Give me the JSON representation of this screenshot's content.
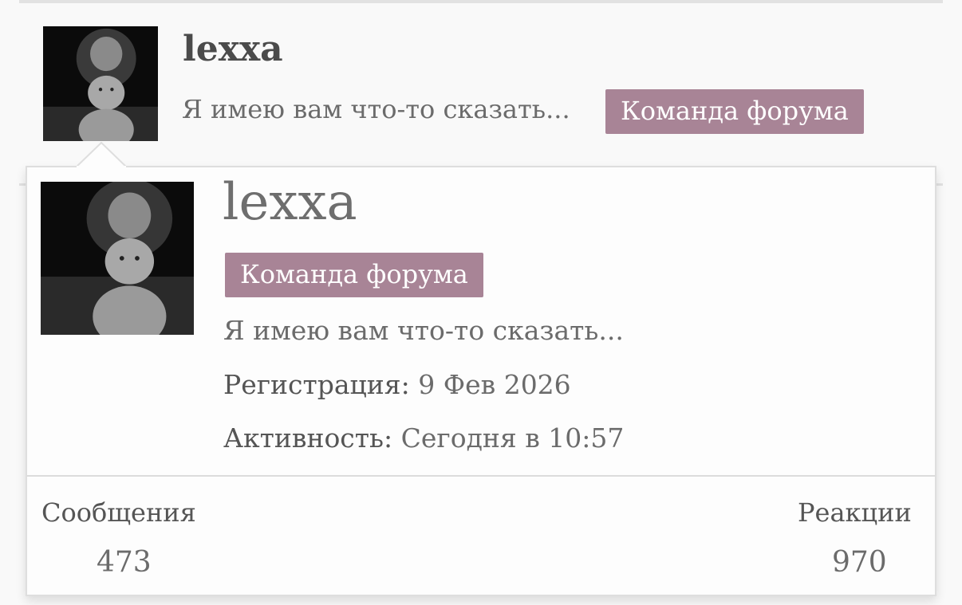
{
  "post": {
    "username": "lexxa",
    "status_text": "Я имею вам что-то сказать...",
    "badge": "Команда форума",
    "avatar_icon": "lion-lioness-avatar"
  },
  "profile_card": {
    "username": "lexxa",
    "badge": "Команда форума",
    "status_text": "Я имею вам что-то сказать...",
    "registration": {
      "label": "Регистрация:",
      "value": "9 Фев 2026"
    },
    "activity": {
      "label": "Активность:",
      "value": "Сегодня в 10:57"
    },
    "stats": [
      {
        "label": "Сообщения",
        "value": "473"
      },
      {
        "label": "Реакции",
        "value": "970"
      }
    ],
    "avatar_icon": "lion-lioness-avatar"
  },
  "colors": {
    "badge_bg": "#a88496",
    "badge_text": "#ffffff",
    "text_primary": "#4b4b4b",
    "text_secondary": "#6b6b6b"
  }
}
